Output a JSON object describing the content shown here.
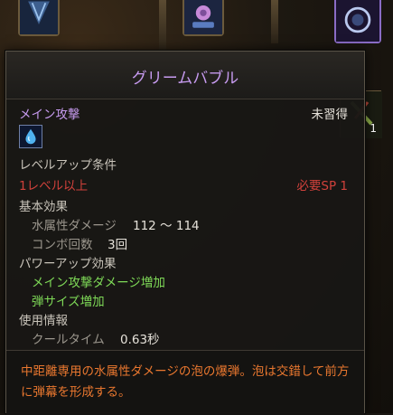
{
  "skill": {
    "name": "グリームバブル",
    "type_label": "メイン攻撃",
    "status": "未習得",
    "element_icon": "water-drop-icon"
  },
  "levelup": {
    "heading": "レベルアップ条件",
    "requirement": "1レベル以上",
    "sp_cost": "必要SP 1"
  },
  "basic": {
    "heading": "基本効果",
    "damage_label": "水属性ダメージ",
    "damage_value": "112 ～ 114",
    "combo_label": "コンボ回数",
    "combo_value": "3回"
  },
  "powerup": {
    "heading": "パワーアップ効果",
    "items": [
      "メイン攻撃ダメージ増加",
      "弾サイズ増加"
    ]
  },
  "usage": {
    "heading": "使用情報",
    "cooldown_label": "クールタイム",
    "cooldown_value": "0.63秒"
  },
  "description": "中距離専用の水属性ダメージの泡の爆弾。泡は交錯して前方に弾幕を形成する。",
  "side_slot": {
    "count": "1"
  },
  "colors": {
    "title": "#c79bf0",
    "requirement": "#d0413b",
    "powerup": "#7ed957",
    "description": "#e9772f"
  }
}
